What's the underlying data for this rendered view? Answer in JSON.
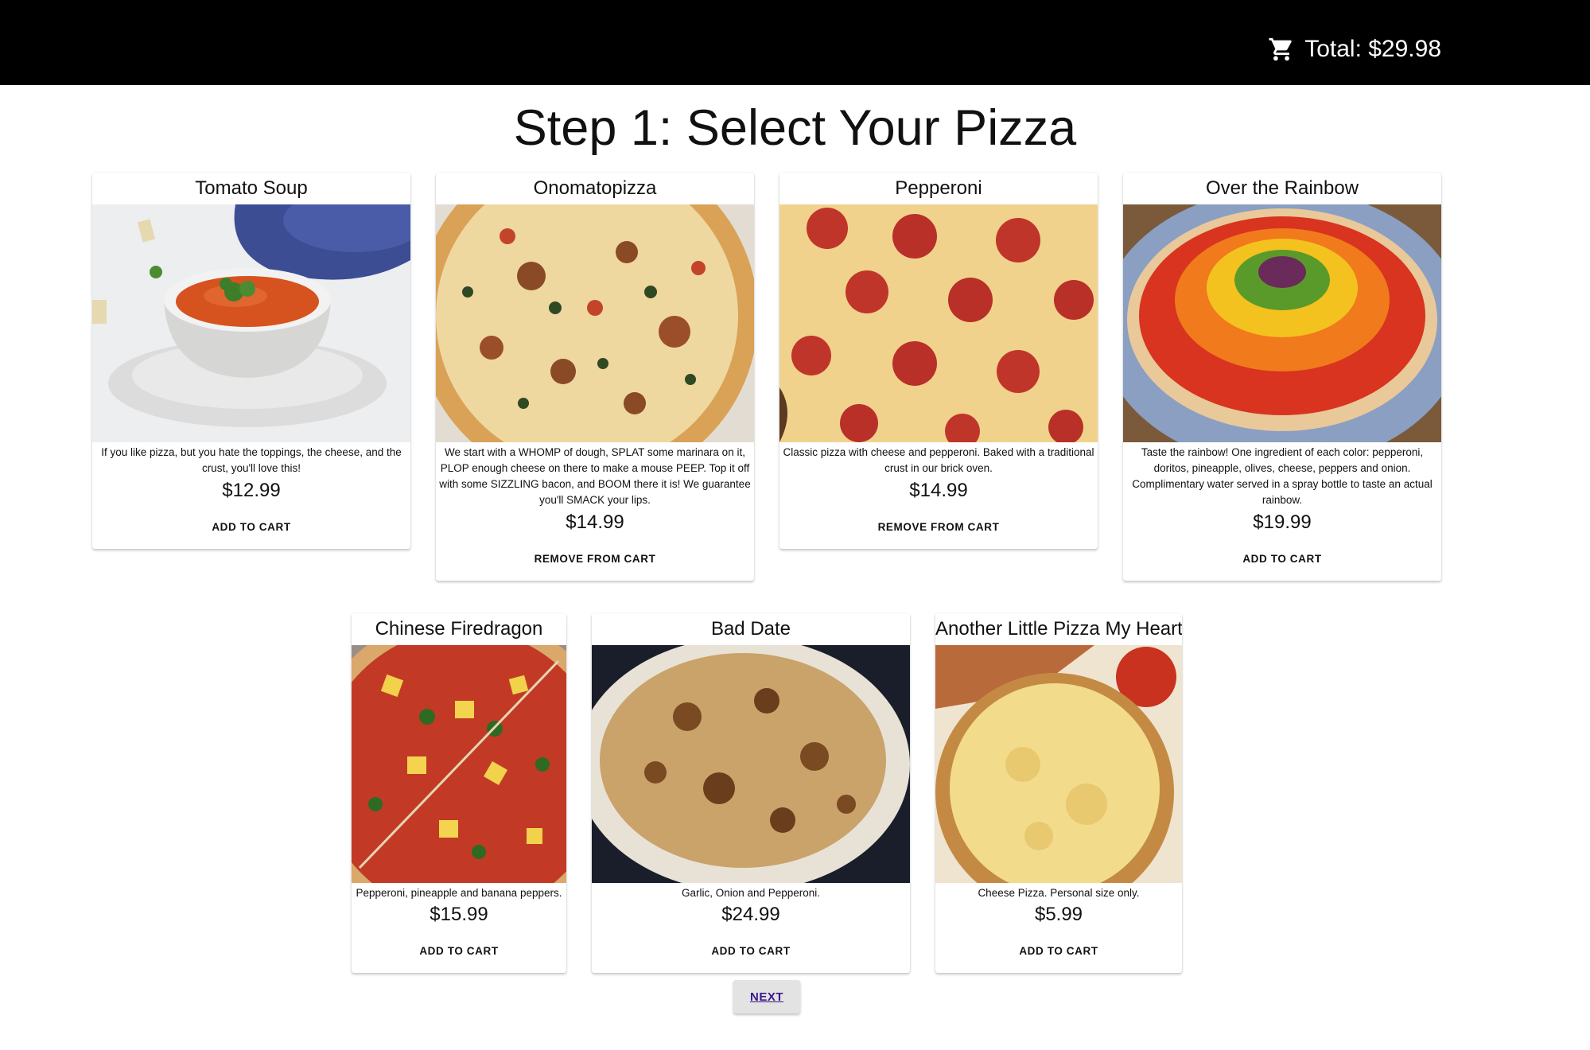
{
  "header": {
    "cart_icon": "shopping-cart-icon",
    "total_label": "Total: $29.98"
  },
  "page": {
    "title": "Step 1: Select Your Pizza",
    "next_label": "NEXT"
  },
  "products": [
    {
      "name": "Tomato Soup",
      "description": "If you like pizza, but you hate the toppings, the cheese, and the crust, you'll love this!",
      "price": "$12.99",
      "button": "ADD TO CART"
    },
    {
      "name": "Onomatopizza",
      "description": "We start with a WHOMP of dough, SPLAT some marinara on it, PLOP enough cheese on there to make a mouse PEEP. Top it off with some SIZZLING bacon, and BOOM there it is! We guarantee you'll SMACK your lips.",
      "price": "$14.99",
      "button": "REMOVE FROM CART"
    },
    {
      "name": "Pepperoni",
      "description": "Classic pizza with cheese and pepperoni. Baked with a traditional crust in our brick oven.",
      "price": "$14.99",
      "button": "REMOVE FROM CART"
    },
    {
      "name": "Over the Rainbow",
      "description": "Taste the rainbow! One ingredient of each color: pepperoni, doritos, pineapple, olives, cheese, peppers and onion. Complimentary water served in a spray bottle to taste an actual rainbow.",
      "price": "$19.99",
      "button": "ADD TO CART"
    },
    {
      "name": "Chinese Firedragon",
      "description": "Pepperoni, pineapple and banana peppers.",
      "price": "$15.99",
      "button": "ADD TO CART"
    },
    {
      "name": "Bad Date",
      "description": "Garlic, Onion and Pepperoni.",
      "price": "$24.99",
      "button": "ADD TO CART"
    },
    {
      "name": "Another Little Pizza My Heart",
      "description": "Cheese Pizza. Personal size only.",
      "price": "$5.99",
      "button": "ADD TO CART"
    }
  ]
}
